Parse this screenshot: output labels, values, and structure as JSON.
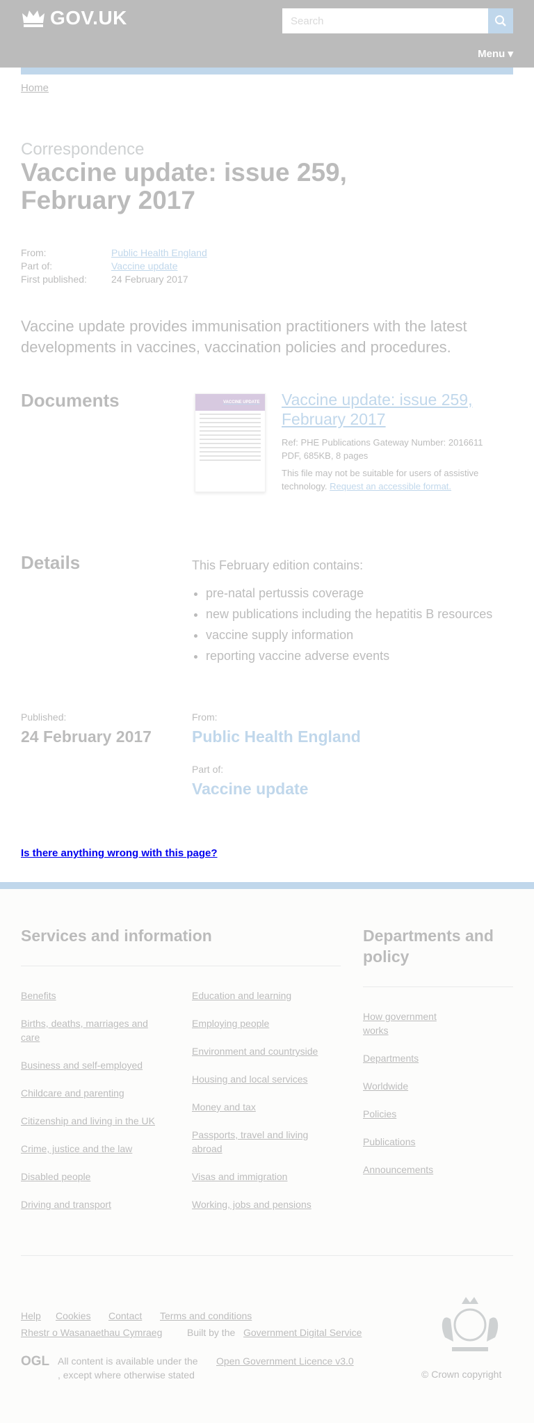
{
  "header": {
    "brand": "GOV.UK",
    "search_placeholder": "Search",
    "menu_label": "Menu ▾"
  },
  "breadcrumb": {
    "home": "Home"
  },
  "page": {
    "caption": "Correspondence",
    "title": "Vaccine update: issue 259, February 2017",
    "meta": [
      {
        "label": "From:",
        "value": "Public Health England",
        "link": true
      },
      {
        "label": "Part of:",
        "value": "Vaccine update",
        "link": true
      },
      {
        "label": "First published:",
        "value": "24 February 2017",
        "link": false
      }
    ],
    "lead": "Vaccine update provides immunisation practitioners with the latest developments in vaccines, vaccination policies and procedures."
  },
  "documents": {
    "heading": "Documents",
    "thumbnail_title": "VACCINE UPDATE",
    "title": "Vaccine update: issue 259, February 2017",
    "ref": "Ref: PHE Publications Gateway Number: 2016611",
    "file_info": "PDF, 685KB, 8 pages",
    "note": "This file may not be suitable for users of assistive technology.",
    "request_link": "Request an accessible format."
  },
  "details": {
    "heading": "Details",
    "intro": "This February edition contains:",
    "items": [
      "pre-natal pertussis coverage",
      "new publications including the hepatitis B resources",
      "vaccine supply information",
      "reporting vaccine adverse events"
    ]
  },
  "metadata_footer": {
    "published_label": "Published:",
    "published_value": "24 February 2017",
    "from_label": "From:",
    "from_value": "Public Health England",
    "partof_label": "Part of:",
    "partof_value": "Vaccine update"
  },
  "feedback": {
    "link": "Is there anything wrong with this page?"
  },
  "footer": {
    "services_heading": "Services and information",
    "services_col1": [
      "Benefits",
      "Births, deaths, marriages and care",
      "Business and self-employed",
      "Childcare and parenting",
      "Citizenship and living in the UK",
      "Crime, justice and the law",
      "Disabled people",
      "Driving and transport"
    ],
    "services_col2": [
      "Education and learning",
      "Employing people",
      "Environment and countryside",
      "Housing and local services",
      "Money and tax",
      "Passports, travel and living abroad",
      "Visas and immigration",
      "Working, jobs and pensions"
    ],
    "departments_heading": "Departments and policy",
    "departments": [
      "How government works",
      "Departments",
      "Worldwide",
      "Policies",
      "Publications",
      "Announcements"
    ],
    "meta_links": [
      "Help",
      "Cookies",
      "Contact",
      "Terms and conditions",
      "Rhestr o Wasanaethau Cymraeg"
    ],
    "built_by_prefix": "Built by the",
    "built_by_link": "Government Digital Service",
    "ogl_label": "OGL",
    "licence_prefix": "All content is available under the",
    "licence_link": "Open Government Licence v3.0",
    "licence_suffix": ", except where otherwise stated",
    "copyright": "© Crown copyright"
  }
}
